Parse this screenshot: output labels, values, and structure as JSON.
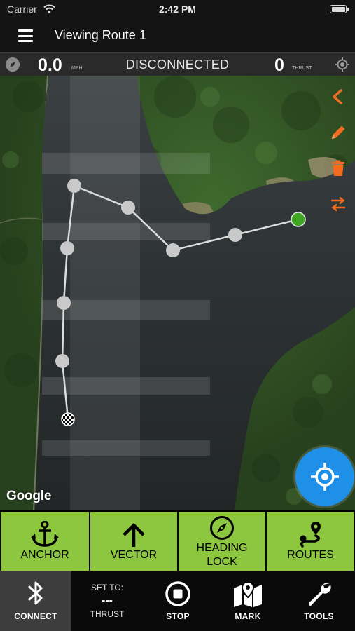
{
  "status_bar": {
    "carrier": "Carrier",
    "time": "2:42 PM"
  },
  "header": {
    "title": "Viewing Route 1"
  },
  "info_bar": {
    "speed": "0.0",
    "speed_unit": "MPH",
    "connection_status": "DISCONNECTED",
    "thrust": "0",
    "thrust_unit": "THRUST"
  },
  "map": {
    "attribution": "Google",
    "tools": [
      "back-icon",
      "edit-icon",
      "trash-icon",
      "reverse-icon"
    ],
    "accent_color": "#f26b21"
  },
  "actions": [
    {
      "label": "ANCHOR",
      "icon": "anchor-icon"
    },
    {
      "label": "VECTOR",
      "icon": "arrow-up-icon"
    },
    {
      "label": "HEADING LOCK",
      "line1": "HEADING",
      "line2": "LOCK",
      "icon": "compass-icon"
    },
    {
      "label": "ROUTES",
      "icon": "route-icon"
    }
  ],
  "action_color": "#8dc63f",
  "tabs": {
    "connect": "CONNECT",
    "set_to": {
      "title": "SET TO:",
      "value": "---",
      "label": "THRUST"
    },
    "stop": "STOP",
    "mark": "MARK",
    "tools": "TOOLS"
  }
}
